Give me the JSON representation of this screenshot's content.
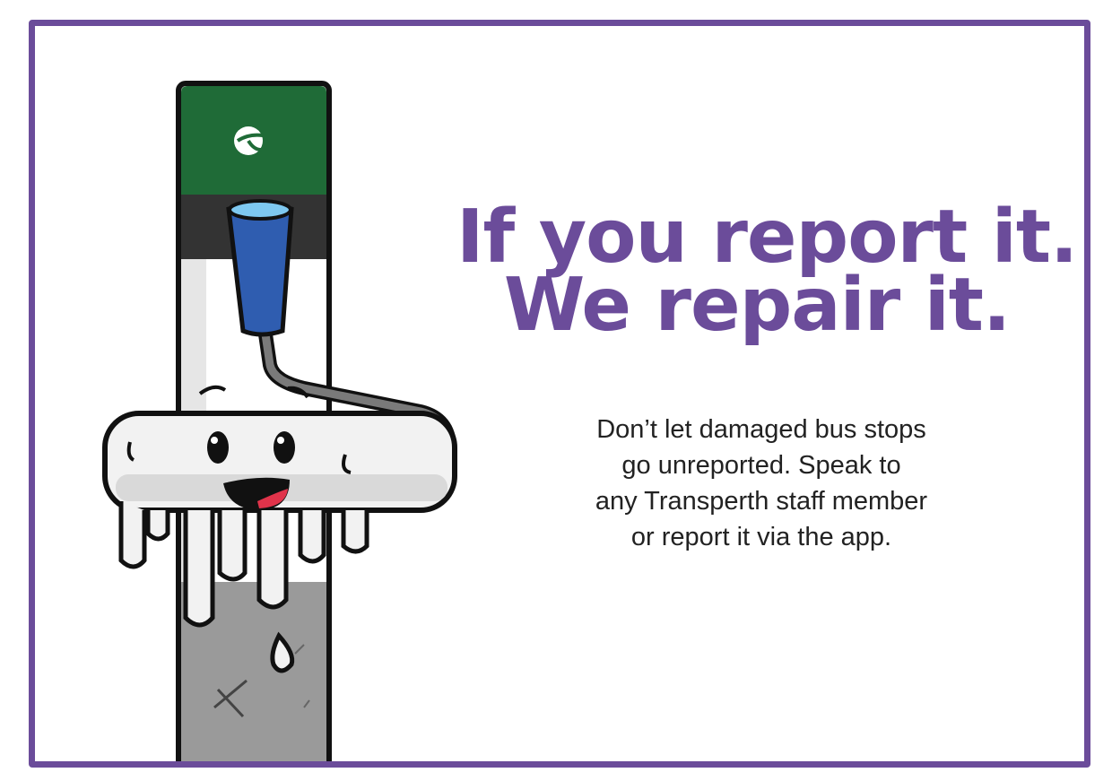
{
  "poster": {
    "headline_line1": "If you report it.",
    "headline_line2": "We repair it.",
    "body_lines": [
      "Don’t let damaged bus stops",
      "go unreported. Speak to",
      "any Transperth staff member",
      "or report it via the app."
    ]
  },
  "illustration": {
    "subject": "bus-stop-pole-with-paint-roller-character",
    "icons": [
      "transperth-logo-icon",
      "paint-roller-icon",
      "paint-drip-icon"
    ]
  },
  "colors": {
    "border": "#6b4c9a",
    "headline": "#6b4c9a",
    "body_text": "#222222",
    "pole_green": "#1f6b37",
    "roller_blue": "#2f5db0",
    "pole_grey": "#9a9a9a"
  }
}
